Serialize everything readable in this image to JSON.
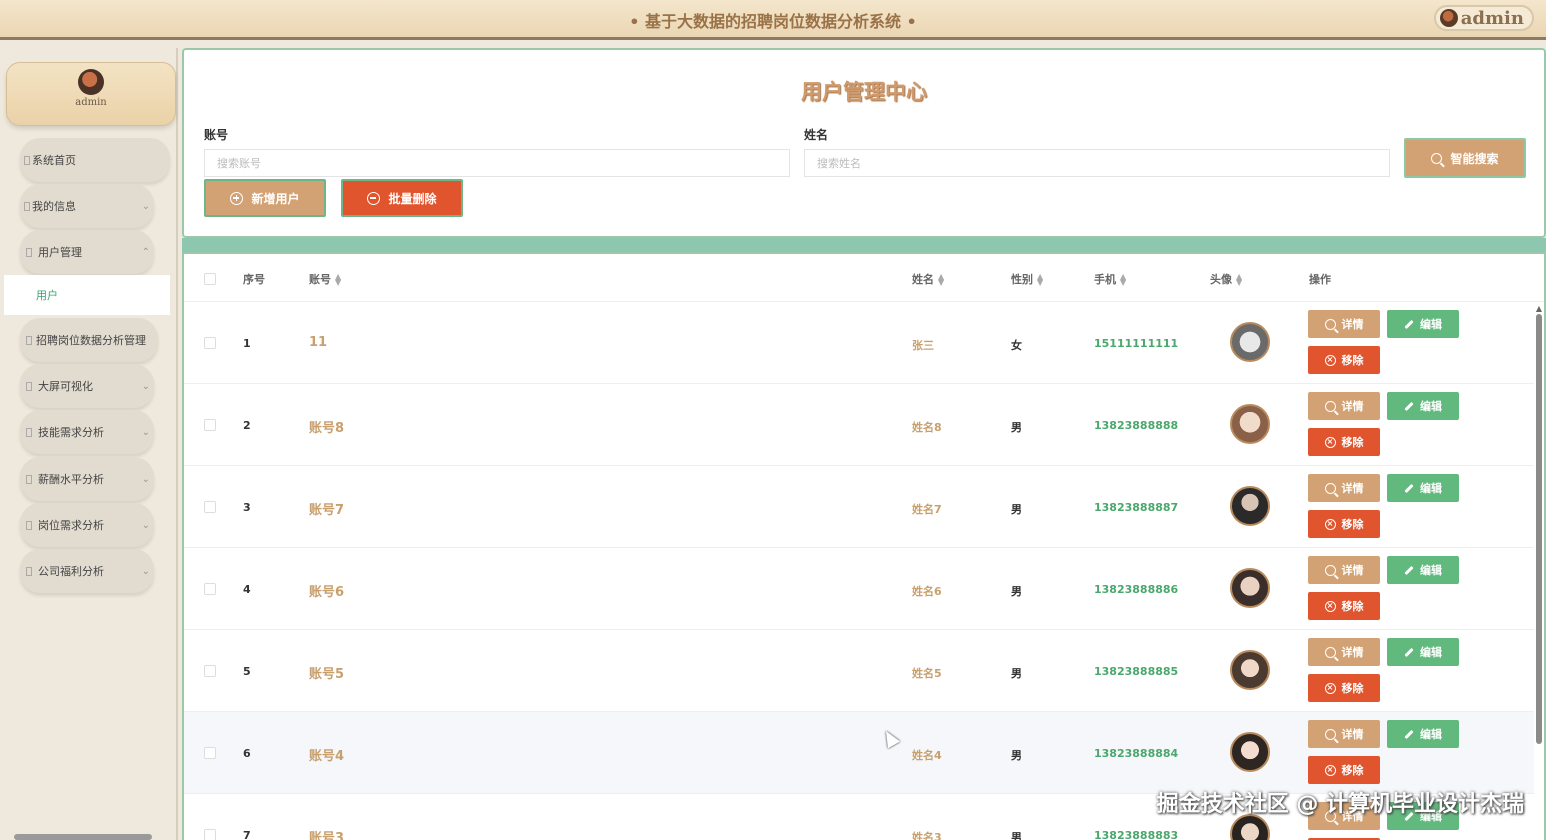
{
  "header": {
    "title": "• 基于大数据的招聘岗位数据分析系统 •",
    "user": "admin"
  },
  "sidebar": {
    "user": "admin",
    "items": [
      {
        "label": "系统首页"
      },
      {
        "label": "我的信息"
      },
      {
        "label": "用户管理"
      },
      {
        "label": "招聘岗位数据分析管理"
      },
      {
        "label": "大屏可视化"
      },
      {
        "label": "技能需求分析"
      },
      {
        "label": "薪酬水平分析"
      },
      {
        "label": "岗位需求分析"
      },
      {
        "label": "公司福利分析"
      }
    ],
    "active_sub": "用户"
  },
  "search": {
    "title": "用户管理中心",
    "account_label": "账号",
    "account_placeholder": "搜索账号",
    "name_label": "姓名",
    "name_placeholder": "搜索姓名",
    "search_button": "智能搜索",
    "add_button": "新增用户",
    "batch_delete_button": "批量删除"
  },
  "table": {
    "headers": {
      "index": "序号",
      "account": "账号",
      "name": "姓名",
      "gender": "性别",
      "phone": "手机",
      "avatar": "头像",
      "actions": "操作"
    },
    "actions": {
      "detail": "详情",
      "edit": "编辑",
      "remove": "移除"
    },
    "rows": [
      {
        "index": "1",
        "account": "11",
        "name": "张三",
        "gender": "女",
        "phone": "15111111111"
      },
      {
        "index": "2",
        "account": "账号8",
        "name": "姓名8",
        "gender": "男",
        "phone": "13823888888"
      },
      {
        "index": "3",
        "account": "账号7",
        "name": "姓名7",
        "gender": "男",
        "phone": "13823888887"
      },
      {
        "index": "4",
        "account": "账号6",
        "name": "姓名6",
        "gender": "男",
        "phone": "13823888886"
      },
      {
        "index": "5",
        "account": "账号5",
        "name": "姓名5",
        "gender": "男",
        "phone": "13823888885"
      },
      {
        "index": "6",
        "account": "账号4",
        "name": "姓名4",
        "gender": "男",
        "phone": "13823888884"
      },
      {
        "index": "7",
        "account": "账号3",
        "name": "姓名3",
        "gender": "男",
        "phone": "13823888883"
      }
    ]
  },
  "watermark": "掘金技术社区 @ 计算机毕业设计杰瑞"
}
